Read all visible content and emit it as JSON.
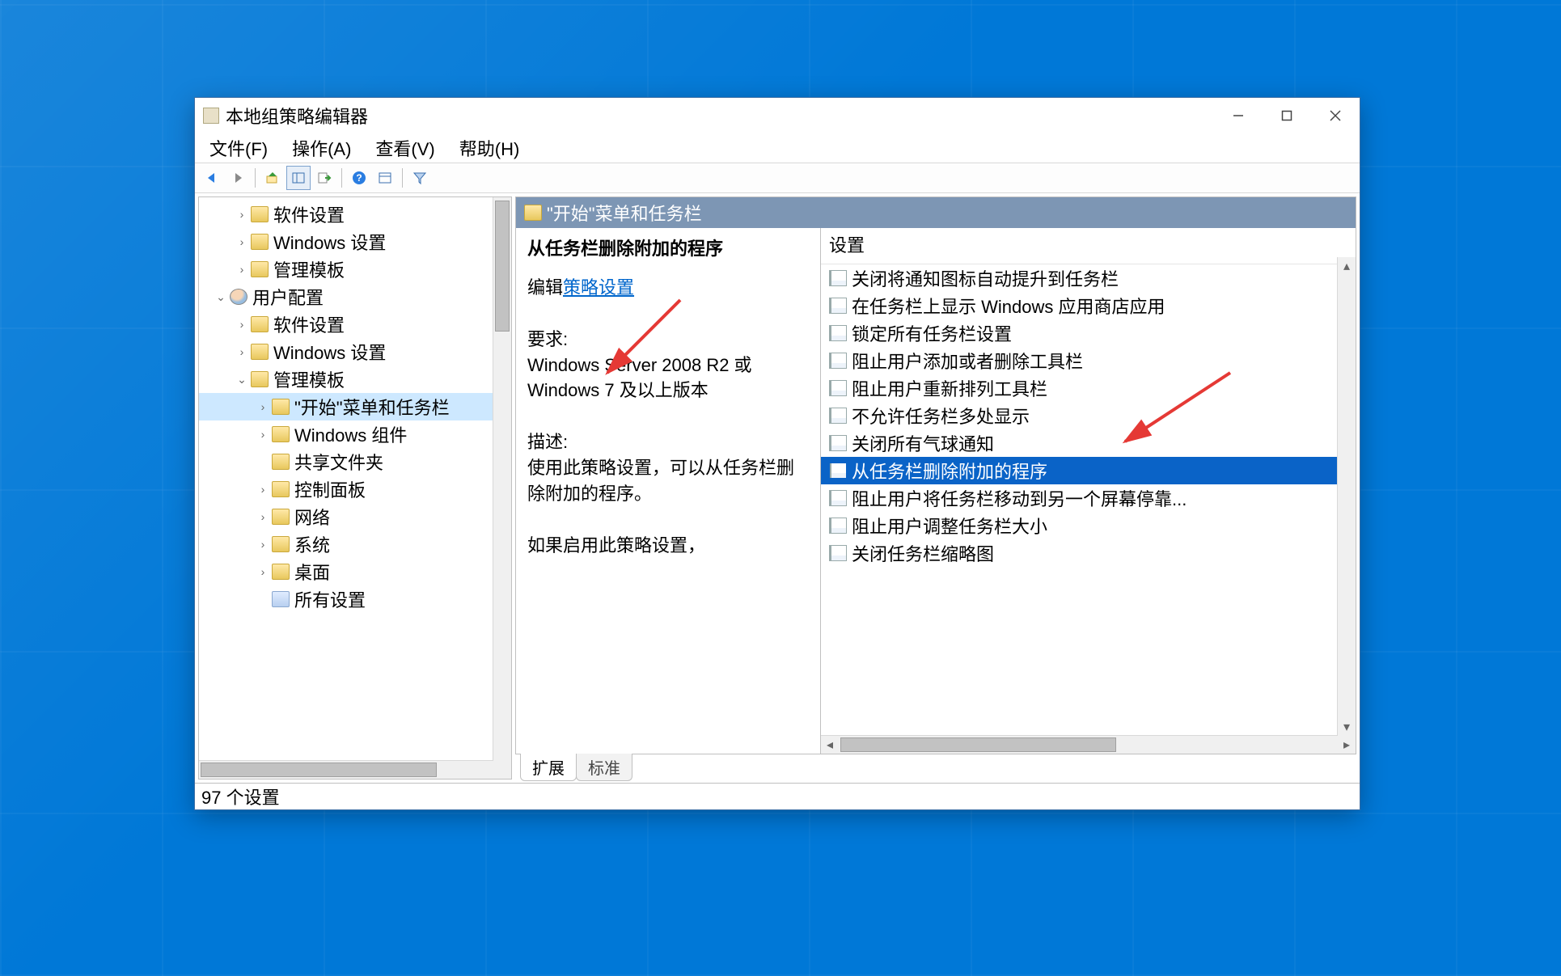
{
  "window": {
    "title": "本地组策略编辑器"
  },
  "menu": {
    "file": "文件(F)",
    "action": "操作(A)",
    "view": "查看(V)",
    "help": "帮助(H)"
  },
  "tree": {
    "items": [
      {
        "depth": 1,
        "exp": "col",
        "icon": "folder",
        "label": "软件设置"
      },
      {
        "depth": 1,
        "exp": "col",
        "icon": "folder",
        "label": "Windows 设置"
      },
      {
        "depth": 1,
        "exp": "col",
        "icon": "folder",
        "label": "管理模板"
      },
      {
        "depth": 0,
        "exp": "exp",
        "icon": "user",
        "label": "用户配置"
      },
      {
        "depth": 1,
        "exp": "col",
        "icon": "folder",
        "label": "软件设置"
      },
      {
        "depth": 1,
        "exp": "col",
        "icon": "folder",
        "label": "Windows 设置"
      },
      {
        "depth": 1,
        "exp": "exp",
        "icon": "folder",
        "label": "管理模板"
      },
      {
        "depth": 2,
        "exp": "col",
        "icon": "folder",
        "label": "\"开始\"菜单和任务栏",
        "selected": true
      },
      {
        "depth": 2,
        "exp": "col",
        "icon": "folder",
        "label": "Windows 组件"
      },
      {
        "depth": 2,
        "exp": "none",
        "icon": "folder",
        "label": "共享文件夹"
      },
      {
        "depth": 2,
        "exp": "col",
        "icon": "folder",
        "label": "控制面板"
      },
      {
        "depth": 2,
        "exp": "col",
        "icon": "folder",
        "label": "网络"
      },
      {
        "depth": 2,
        "exp": "col",
        "icon": "folder",
        "label": "系统"
      },
      {
        "depth": 2,
        "exp": "col",
        "icon": "folder",
        "label": "桌面"
      },
      {
        "depth": 2,
        "exp": "none",
        "icon": "sett",
        "label": "所有设置"
      }
    ]
  },
  "crumb": "\"开始\"菜单和任务栏",
  "desc": {
    "title": "从任务栏删除附加的程序",
    "edit_prefix": "编辑",
    "edit_link": "策略设置",
    "req_label": "要求:",
    "req_body": "Windows Server 2008 R2 或 Windows 7 及以上版本",
    "desc_label": "描述:",
    "desc_body": "使用此策略设置，可以从任务栏删除附加的程序。",
    "desc_more": "如果启用此策略设置，"
  },
  "list": {
    "header": "设置",
    "rows": [
      {
        "label": "关闭将通知图标自动提升到任务栏"
      },
      {
        "label": "在任务栏上显示 Windows 应用商店应用"
      },
      {
        "label": "锁定所有任务栏设置"
      },
      {
        "label": "阻止用户添加或者删除工具栏"
      },
      {
        "label": "阻止用户重新排列工具栏"
      },
      {
        "label": "不允许任务栏多处显示"
      },
      {
        "label": "关闭所有气球通知"
      },
      {
        "label": "从任务栏删除附加的程序",
        "selected": true
      },
      {
        "label": "阻止用户将任务栏移动到另一个屏幕停靠..."
      },
      {
        "label": "阻止用户调整任务栏大小"
      },
      {
        "label": "关闭任务栏缩略图"
      }
    ]
  },
  "tabs": {
    "extended": "扩展",
    "standard": "标准"
  },
  "status": "97 个设置"
}
